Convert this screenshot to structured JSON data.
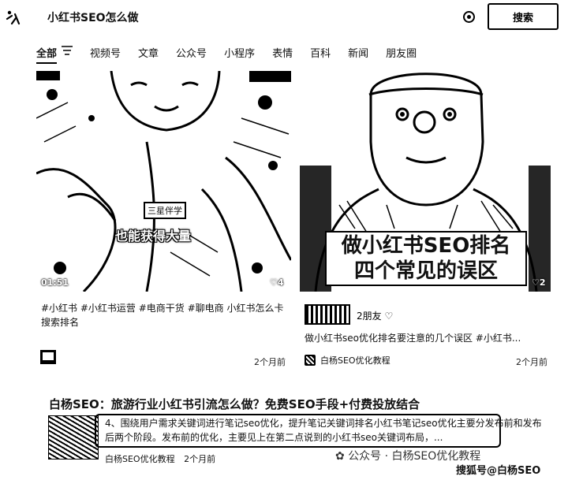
{
  "search": {
    "query": "小红书SEO怎么做",
    "button_label": "搜索"
  },
  "tabs": [
    "全部",
    "视频号",
    "文章",
    "公众号",
    "小程序",
    "表情",
    "百科",
    "新闻",
    "朋友圈"
  ],
  "cards": [
    {
      "duration": "01:51",
      "likes": "4",
      "name_tag": "三星伴学",
      "caption": "也能获得大量",
      "title": "#小红书 #小红书运营 #电商干货 #聊电商 小红书怎么卡搜索排名",
      "time": "2个月前"
    },
    {
      "likes": "2",
      "badge_line1": "做小红书SEO排名",
      "badge_line2": "四个常见的误区",
      "friends": "2朋友",
      "title": "做小红书seo优化排名要注意的几个误区 #小红书...",
      "author": "白杨SEO优化教程",
      "time": "2个月前"
    }
  ],
  "article": {
    "title": "白杨SEO：旅游行业小红书引流怎么做？免费SEO手段+付费投放结合",
    "snippet": "4、围绕用户需求关键词进行笔记seo优化，提升笔记关键词排名小红书笔记seo优化主要分发布前和发布后两个阶段。发布前的优化，主要见上在第二点说到的小红书seo关键词布局，...",
    "source": "白杨SEO优化教程",
    "time": "2个月前"
  },
  "watermarks": {
    "line1": "公众号 · 白杨SEO优化教程",
    "line2": "搜狐号@白杨SEO"
  }
}
